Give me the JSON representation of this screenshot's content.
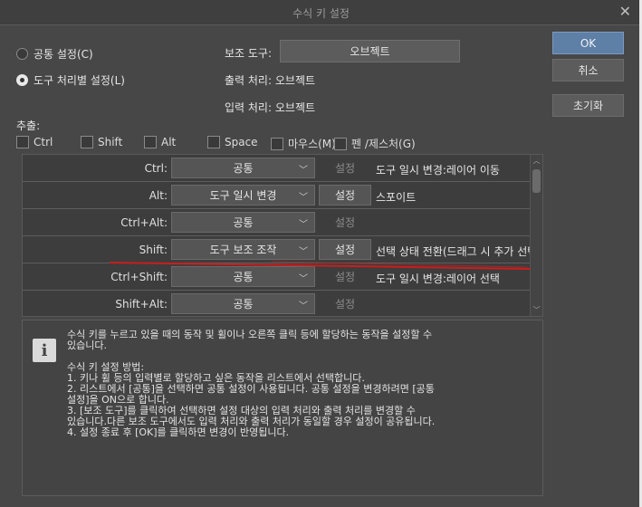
{
  "window": {
    "title": "수식 키 설정",
    "close_glyph": "✕"
  },
  "mode": {
    "common_label": "공통 설정(C)",
    "per_tool_label": "도구 처리별 설정(L)",
    "selected": "per_tool"
  },
  "subtool": {
    "label": "보조 도구:",
    "value": "오브젝트",
    "output_label": "출력 처리:",
    "output_value": "오브젝트",
    "input_label": "입력 처리:",
    "input_value": "오브젝트"
  },
  "buttons": {
    "ok": "OK",
    "cancel": "취소",
    "reset": "초기화"
  },
  "extract": {
    "label": "추출:",
    "items": [
      "Ctrl",
      "Shift",
      "Alt",
      "Space",
      "마우스(M)",
      "펜 /제스처(G)"
    ]
  },
  "rows": [
    {
      "key": "Ctrl:",
      "action": "공통",
      "set": "설정",
      "set_enabled": false,
      "desc": "도구 일시 변경:레이어 이동"
    },
    {
      "key": "Alt:",
      "action": "도구 일시 변경",
      "set": "설정",
      "set_enabled": true,
      "desc": "스포이트"
    },
    {
      "key": "Ctrl+Alt:",
      "action": "공통",
      "set": "설정",
      "set_enabled": false,
      "desc": ""
    },
    {
      "key": "Shift:",
      "action": "도구 보조 조작",
      "set": "설정",
      "set_enabled": true,
      "desc": "선택 상태 전환(드래그 시 추가 선택)"
    },
    {
      "key": "Ctrl+Shift:",
      "action": "공통",
      "set": "설정",
      "set_enabled": false,
      "desc": "도구 일시 변경:레이어 선택"
    },
    {
      "key": "Shift+Alt:",
      "action": "공통",
      "set": "설정",
      "set_enabled": false,
      "desc": ""
    }
  ],
  "info": {
    "icon": "i",
    "lines": [
      "수식 키를 누르고 있을 때의 동작 및 휠이나 오른쪽 클릭 등에 할당하는 동작을 설정할 수",
      "있습니다.",
      "",
      "수식 키 설정 방법:",
      "1. 키나 휠 등의 입력별로 할당하고 싶은 동작을 리스트에서 선택합니다.",
      "2. 리스트에서 [공통]을 선택하면 공통 설정이 사용됩니다. 공통 설정을 변경하려면 [공통",
      "설정]을 ON으로 합니다.",
      "3. [보조 도구]를 클릭하여 선택하면 설정 대상의 입력 처리와 출력 처리를 변경할 수",
      "있습니다.다른 보조 도구에서도 입력 처리와 출력 처리가 동일할 경우 설정이 공유됩니다.",
      "4. 설정 종료 후 [OK]를 클릭하면 변경이 반영됩니다."
    ]
  },
  "colors": {
    "dialog_bg": "#474747",
    "ok_button": "#5e7fa6",
    "annotation_underline": "#c81e1e"
  }
}
